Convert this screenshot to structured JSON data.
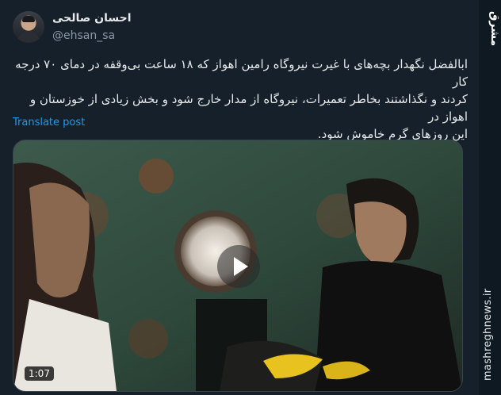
{
  "author": {
    "display_name": "احسان صالحی",
    "handle": "@ehsan_sa"
  },
  "post": {
    "text": "ابالفضل نگهدار بچه‌های با غیرت نیروگاه رامین اهواز که ۱۸ ساعت بی‌وقفه در دمای ۷۰ درجه کار\nکردند و نگذاشتند بخاطر تعمیرات، نیروگاه از مدار خارج شود و بخش زیادی از خوزستان و اهواز در\nاین روزهای گرم خاموش شود.",
    "translate_label": "Translate post"
  },
  "media": {
    "duration": "1:07",
    "play_icon": "play-icon"
  },
  "watermark": {
    "logo": "مشرق",
    "url": "mashreghnews.ir"
  },
  "colors": {
    "background": "#15202b",
    "link": "#1d9bf0",
    "secondary_text": "#8b98a5"
  }
}
